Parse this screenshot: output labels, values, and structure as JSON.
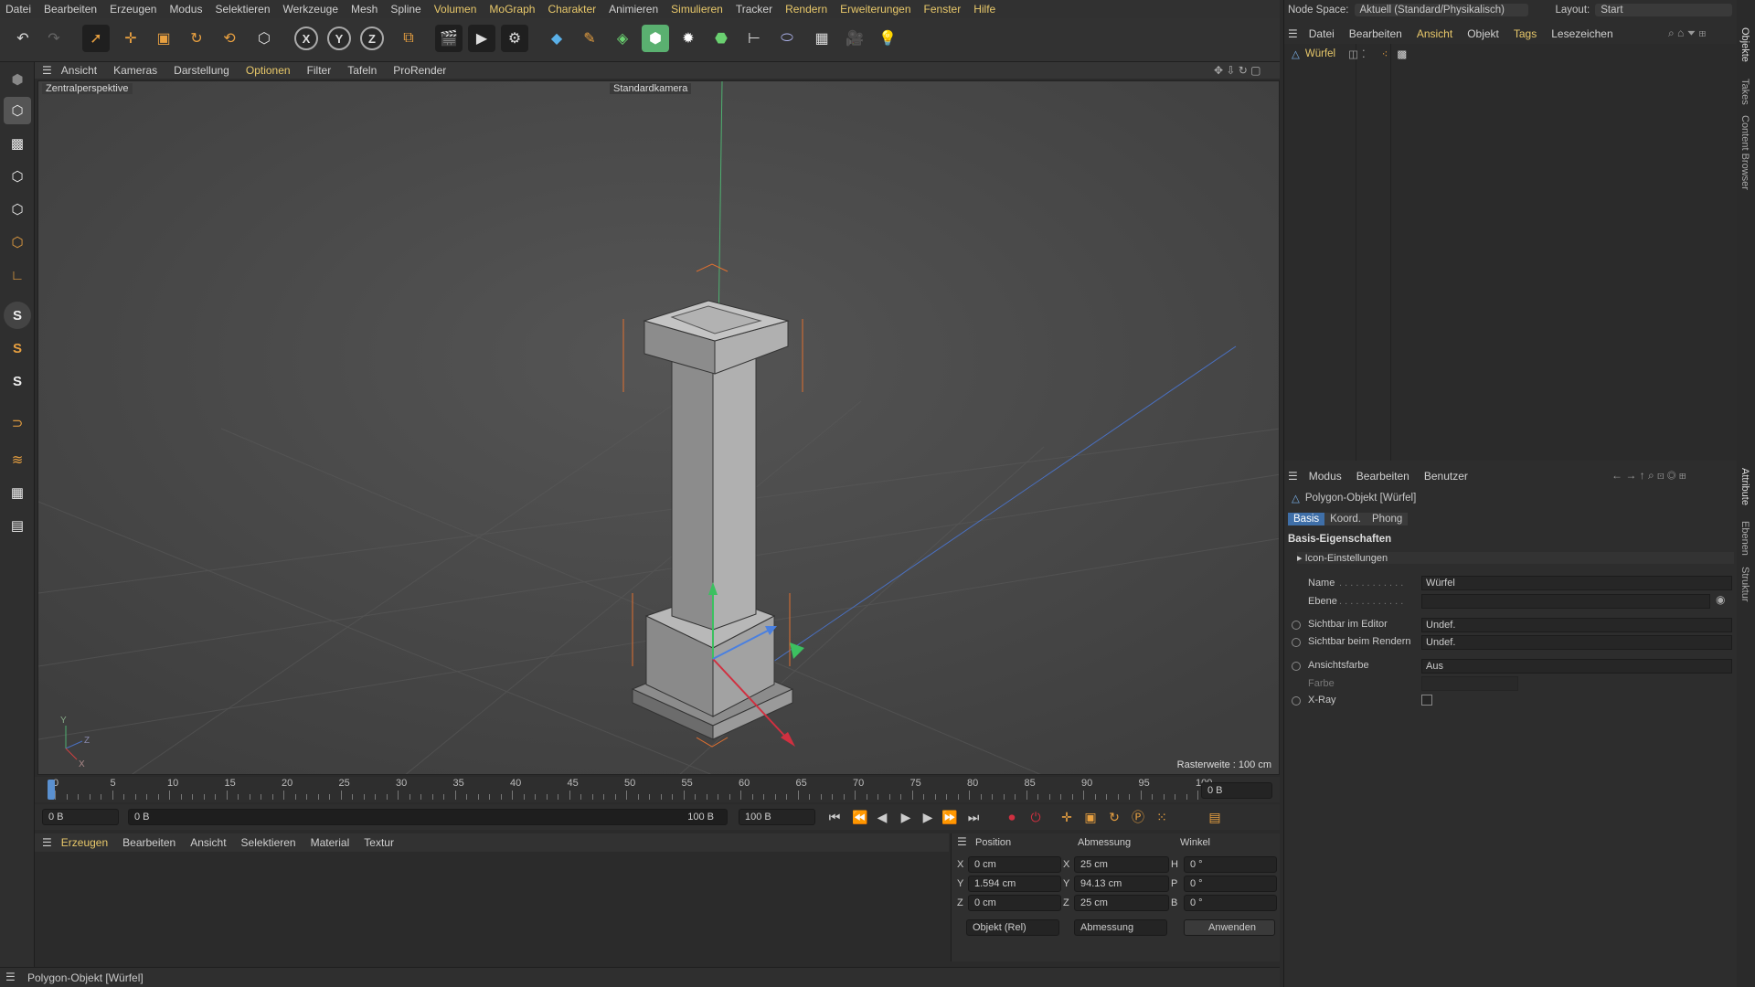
{
  "menu": [
    "Datei",
    "Bearbeiten",
    "Erzeugen",
    "Modus",
    "Selektieren",
    "Werkzeuge",
    "Mesh",
    "Spline",
    "Volumen",
    "MoGraph",
    "Charakter",
    "Animieren",
    "Simulieren",
    "Tracker",
    "Rendern",
    "Erweiterungen",
    "Fenster",
    "Hilfe"
  ],
  "top_right": {
    "node_space_label": "Node Space:",
    "node_space_value": "Aktuell (Standard/Physikalisch)",
    "layout_label": "Layout:",
    "layout_value": "Start"
  },
  "viewport_menu": [
    "Ansicht",
    "Kameras",
    "Darstellung",
    "Optionen",
    "Filter",
    "Tafeln",
    "ProRender"
  ],
  "viewport": {
    "perspective": "Zentralperspektive",
    "camera": "Standardkamera",
    "grid_info": "Rasterweite : 100 cm"
  },
  "timeline": {
    "ticks": [
      "0",
      "5",
      "10",
      "15",
      "20",
      "25",
      "30",
      "35",
      "40",
      "45",
      "50",
      "55",
      "60",
      "65",
      "70",
      "75",
      "80",
      "85",
      "90",
      "95",
      "100"
    ],
    "current_frame": "0 B"
  },
  "playbar": {
    "start": "0 B",
    "range_start": "0 B",
    "range_end": "100 B",
    "end": "100 B"
  },
  "material_menu": [
    "Erzeugen",
    "Bearbeiten",
    "Ansicht",
    "Selektieren",
    "Material",
    "Textur"
  ],
  "coords": {
    "headers": [
      "Position",
      "Abmessung",
      "Winkel"
    ],
    "rows": [
      {
        "axis": "X",
        "pos": "0 cm",
        "dim_axis": "X",
        "dim": "25 cm",
        "ang_axis": "H",
        "ang": "0 °"
      },
      {
        "axis": "Y",
        "pos": "1.594 cm",
        "dim_axis": "Y",
        "dim": "94.13 cm",
        "ang_axis": "P",
        "ang": "0 °"
      },
      {
        "axis": "Z",
        "pos": "0 cm",
        "dim_axis": "Z",
        "dim": "25 cm",
        "ang_axis": "B",
        "ang": "0 °"
      }
    ],
    "mode": "Objekt (Rel)",
    "size_mode": "Abmessung",
    "apply": "Anwenden"
  },
  "status": "Polygon-Objekt [Würfel]",
  "objects_menu": [
    "Datei",
    "Bearbeiten",
    "Ansicht",
    "Objekt",
    "Tags",
    "Lesezeichen"
  ],
  "object_item": "Würfel",
  "attr_menu": [
    "Modus",
    "Bearbeiten",
    "Benutzer"
  ],
  "attr": {
    "title": "Polygon-Objekt [Würfel]",
    "tabs": [
      "Basis",
      "Koord.",
      "Phong"
    ],
    "section": "Basis-Eigenschaften",
    "subsection": "Icon-Einstellungen",
    "name_label": "Name",
    "name_value": "Würfel",
    "layer_label": "Ebene",
    "vis_editor_label": "Sichtbar im Editor",
    "vis_editor_value": "Undef.",
    "vis_render_label": "Sichtbar beim Rendern",
    "vis_render_value": "Undef.",
    "color_label": "Ansichtsfarbe",
    "color_value": "Aus",
    "farbe_label": "Farbe",
    "xray_label": "X-Ray"
  },
  "side_tabs": [
    "Objekte",
    "Takes",
    "Content Browser",
    "Attribute",
    "Ebenen",
    "Struktur"
  ],
  "colors": {
    "accent": "#e8c86a",
    "x_axis": "#d04040",
    "y_axis": "#40c040",
    "z_axis": "#4070d0"
  }
}
